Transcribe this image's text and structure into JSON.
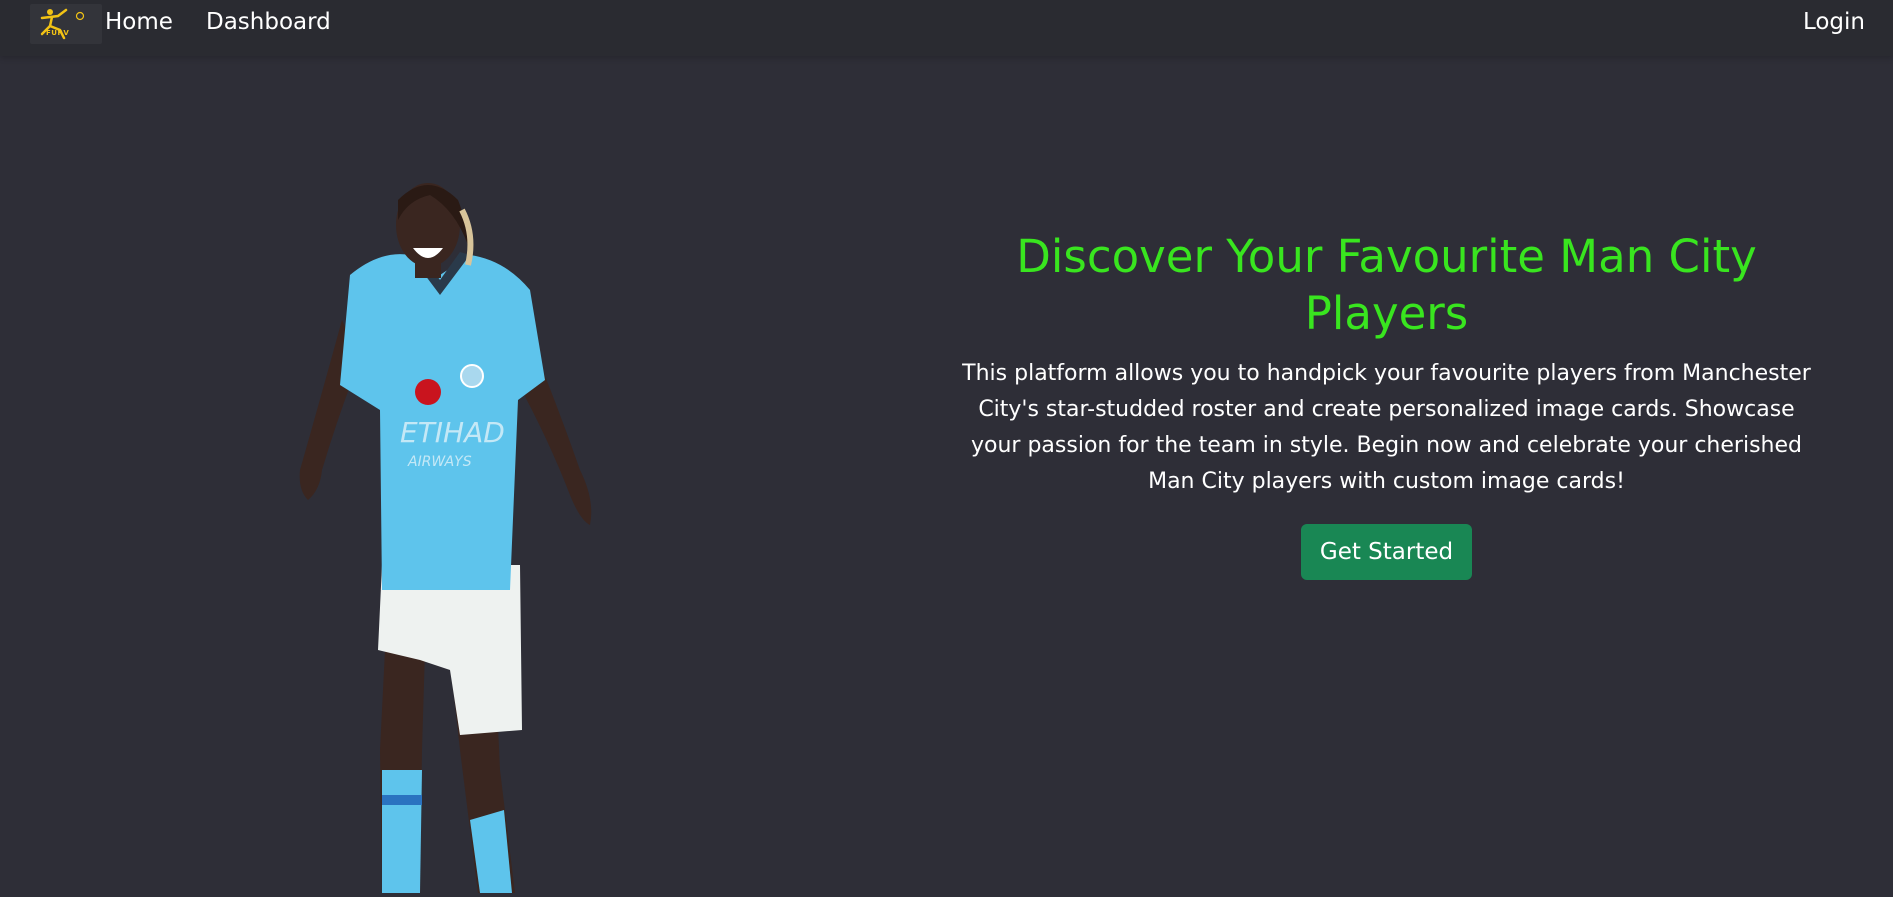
{
  "nav": {
    "logo_text": "FURV",
    "home": "Home",
    "dashboard": "Dashboard",
    "login": "Login"
  },
  "hero": {
    "title_line1": "Discover Your Favourite Man City",
    "title_line2": "Players",
    "description": "This platform allows you to handpick your favourite players from Manchester City's star-studded roster and create personalized image cards. Showcase your passion for the team in style. Begin now and celebrate your cherished Man City players with custom image cards!",
    "cta_label": "Get Started"
  },
  "colors": {
    "background": "#2e2e37",
    "navbar": "#2a2b31",
    "title": "#39e51f",
    "cta": "#198754",
    "jersey": "#5ec4ec",
    "logo_accent": "#f2c315"
  },
  "icons": {
    "logo": "footballer-logo-icon",
    "hero_image": "player-photo"
  }
}
